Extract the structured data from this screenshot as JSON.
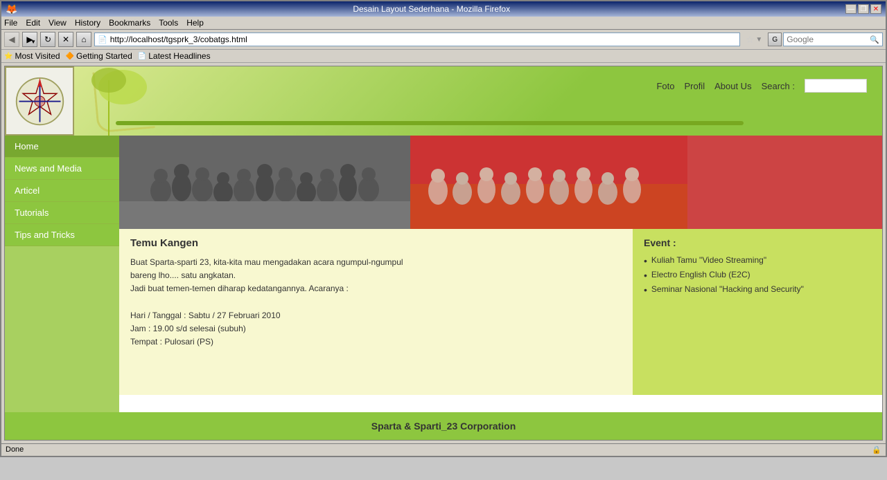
{
  "browser": {
    "title": "Desain Layout Sederhana - Mozilla Firefox",
    "url": "http://localhost/tgsprk_3/cobatgs.html",
    "back_btn": "◀",
    "forward_btn": "▶",
    "reload_btn": "↻",
    "stop_btn": "✕",
    "home_btn": "⌂",
    "minimize": "—",
    "maximize": "❐",
    "close": "✕",
    "search_placeholder": "Google",
    "bookmarks": [
      {
        "label": "Most Visited",
        "icon": "★"
      },
      {
        "label": "Getting Started",
        "icon": "🔶"
      },
      {
        "label": "Latest Headlines",
        "icon": "📄"
      }
    ],
    "menu_items": [
      "File",
      "Edit",
      "View",
      "History",
      "Bookmarks",
      "Tools",
      "Help"
    ]
  },
  "header": {
    "nav_links": [
      "Foto",
      "Profil",
      "About Us"
    ],
    "search_label": "Search :",
    "search_placeholder": ""
  },
  "sidebar": {
    "items": [
      {
        "label": "Home",
        "active": true
      },
      {
        "label": "News and Media",
        "active": false
      },
      {
        "label": "Articel",
        "active": false
      },
      {
        "label": "Tutorials",
        "active": false
      },
      {
        "label": "Tips and Tricks",
        "active": false
      }
    ]
  },
  "article": {
    "title": "Temu Kangen",
    "body_line1": "Buat Sparta-sparti 23, kita-kita mau mengadakan acara ngumpul-ngumpul",
    "body_line2": "bareng lho.... satu angkatan.",
    "body_line3": "Jadi buat temen-temen diharap kedatangannya. Acaranya :",
    "body_line4": "",
    "body_line5": "Hari / Tanggal : Sabtu / 27 Februari 2010",
    "body_line6": "Jam : 19.00 s/d selesai (subuh)",
    "body_line7": "Tempat : Pulosari (PS)"
  },
  "event": {
    "title": "Event :",
    "items": [
      {
        "text": "Kuliah Tamu \"Video Streaming\""
      },
      {
        "text": "Electro English Club (E2C)"
      },
      {
        "text": "Seminar Nasional \"Hacking and Security\""
      }
    ]
  },
  "footer": {
    "text": "Sparta & Sparti_23 Corporation"
  },
  "status_bar": {
    "text": "Done"
  }
}
